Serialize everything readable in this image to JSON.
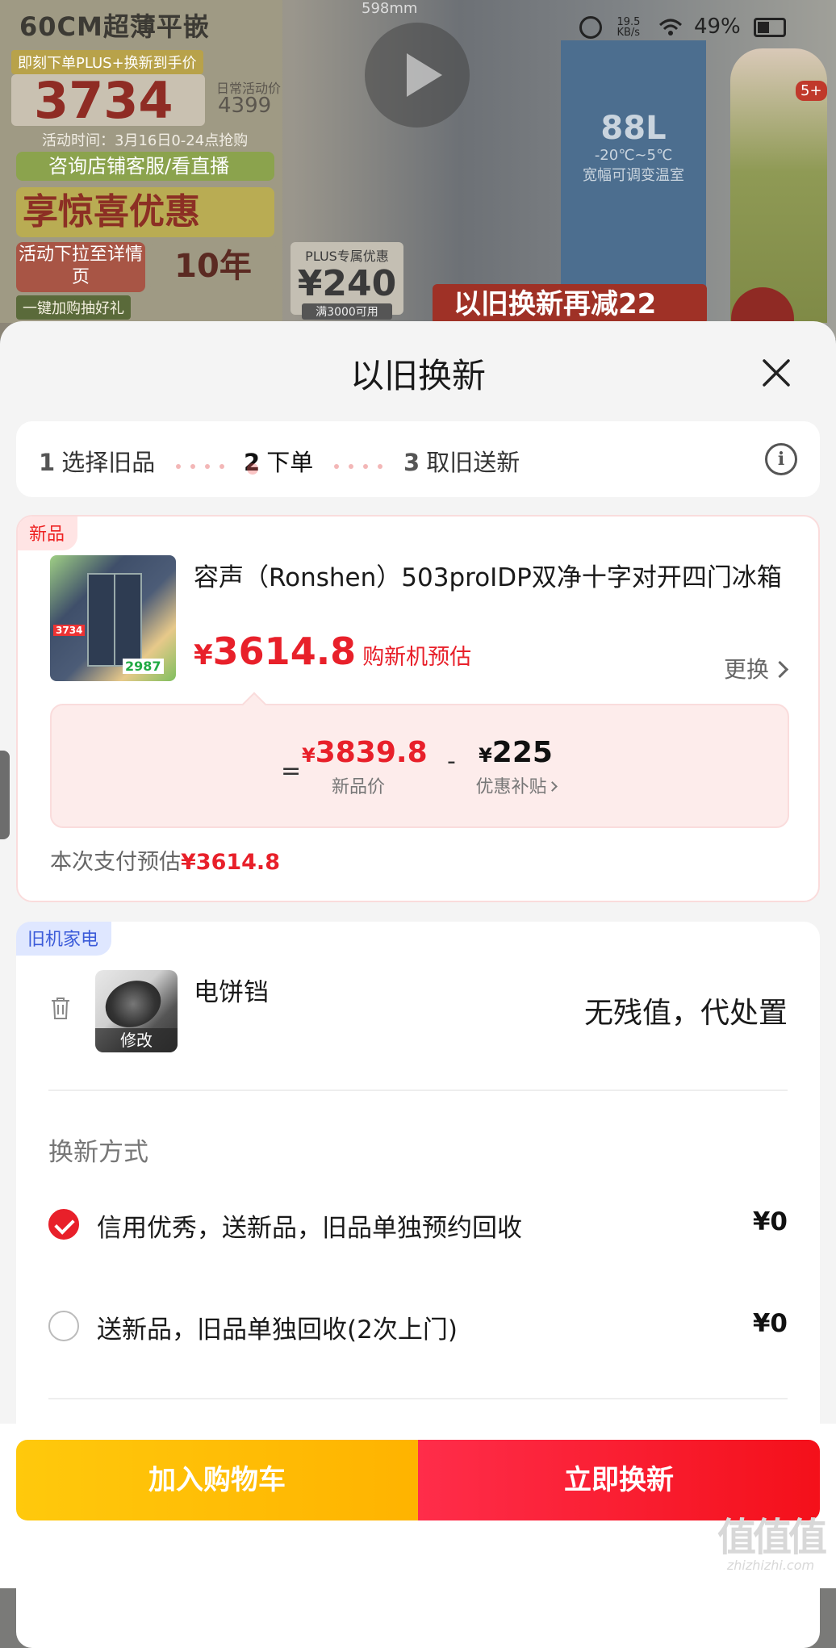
{
  "status_bar": {
    "speed_value": "19.5",
    "speed_unit": "KB/s",
    "battery": "49%"
  },
  "background_page": {
    "headline": "60CM超薄平嵌",
    "size_text": "598mm",
    "order_line": "即刻下单PLUS+换新到手价",
    "hand_price": "3734",
    "daily_label": "日常活动价",
    "daily_value": "4399",
    "activity_time": "活动时间：3月16日0-24点抢购",
    "consult": "咨询店铺客服/看直播",
    "surprise": "享惊喜优惠",
    "pull_down": "活动下拉至详情页",
    "warranty": "10年",
    "bottom_left": "一键加购抽好礼",
    "plus_title": "PLUS专属优惠",
    "plus_value": "¥240",
    "plus_note": "满3000可用",
    "door_capacity": "88L",
    "door_temp": "-20℃~5℃",
    "door_desc": "宽幅可调变温室",
    "red_banner": "以旧换新再减22",
    "badge": "5+"
  },
  "sheet": {
    "title": "以旧换新",
    "steps": [
      {
        "num": "1",
        "label": "选择旧品"
      },
      {
        "num": "2",
        "label": "下单"
      },
      {
        "num": "3",
        "label": "取旧送新"
      }
    ],
    "new_item": {
      "tag": "新品",
      "name": "容声（Ronshen）503proIDP双净十字对开四门冰箱",
      "price_symbol": "¥",
      "price": "3614.8",
      "price_label": "购新机预估",
      "change_label": "更换",
      "calc": {
        "equals": "=",
        "minus": "-",
        "new_price_symbol": "¥",
        "new_price": "3839.8",
        "new_price_label": "新品价",
        "subsidy_symbol": "¥",
        "subsidy": "225",
        "subsidy_label": "优惠补贴"
      },
      "pay_label": "本次支付预估",
      "pay_value": "¥3614.8"
    },
    "old_item": {
      "tag": "旧机家电",
      "name": "电饼铛",
      "modify_label": "修改",
      "value_text": "无残值，代处置"
    },
    "method": {
      "title": "换新方式",
      "options": [
        {
          "label": "信用优秀，送新品，旧品单独预约回收",
          "price": "¥0",
          "selected": true
        },
        {
          "label": "送新品，旧品单独回收(2次上门)",
          "price": "¥0",
          "selected": false
        }
      ]
    },
    "actions": {
      "add_cart": "加入购物车",
      "trade_now": "立即换新"
    }
  },
  "watermark": {
    "logo": "值值值",
    "url": "zhizhizhi.com"
  },
  "colors": {
    "accent_red": "#e8202a",
    "cart_yellow": "#ffc90c",
    "trade_red": "#f4101a",
    "old_tag_blue": "#3b5bd9"
  }
}
